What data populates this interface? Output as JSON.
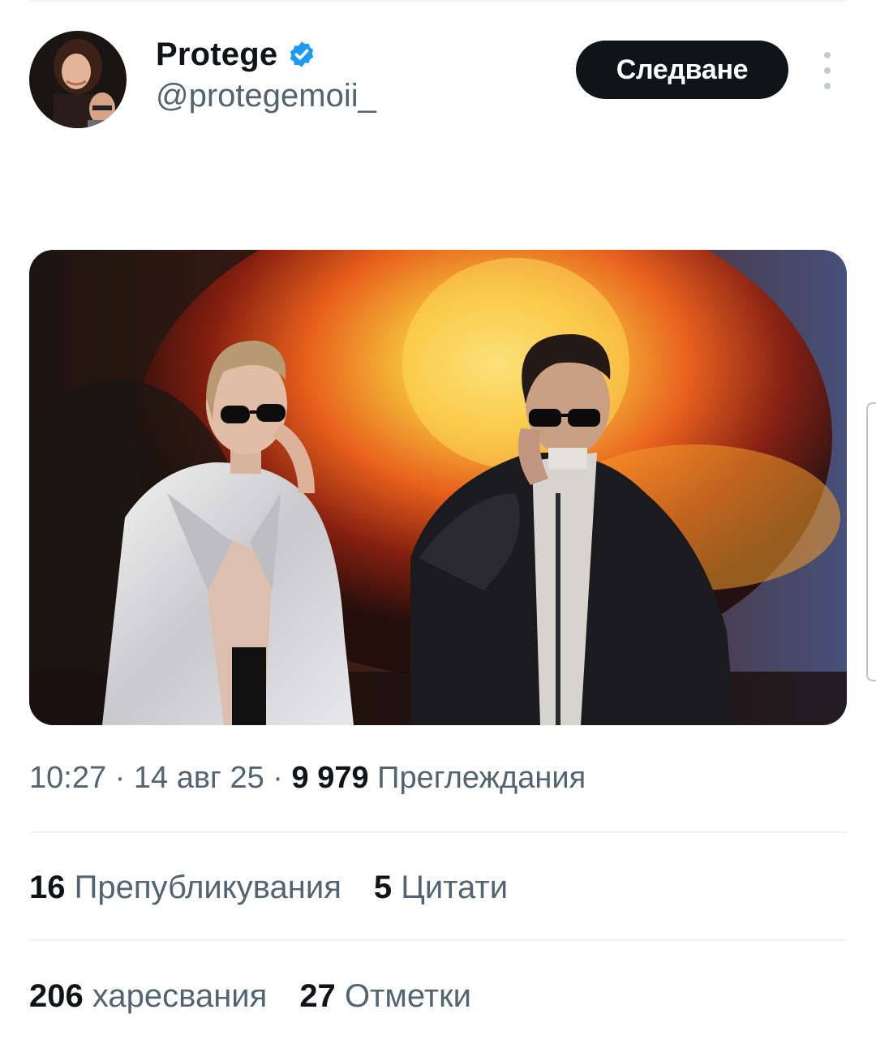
{
  "post": {
    "author": {
      "display_name": "Protege",
      "handle": "@protegemoii_",
      "verified_icon": "verified-badge-icon"
    },
    "follow_label": "Следване",
    "more_icon": "more-vertical-icon",
    "timestamp": {
      "time": "10:27",
      "separator": "·",
      "date": "14 авг 25",
      "views_count": "9 979",
      "views_label": "Преглеждания"
    },
    "stats": {
      "reposts_count": "16",
      "reposts_label": "Препубликувания",
      "quotes_count": "5",
      "quotes_label": "Цитати",
      "likes_count": "206",
      "likes_label": "харесвания",
      "bookmarks_count": "27",
      "bookmarks_label": "Отметки"
    }
  },
  "colors": {
    "accent_blue": "#1d9bf0",
    "text_primary": "#0f1419",
    "text_secondary": "#536471",
    "divider": "#eff3f4"
  }
}
